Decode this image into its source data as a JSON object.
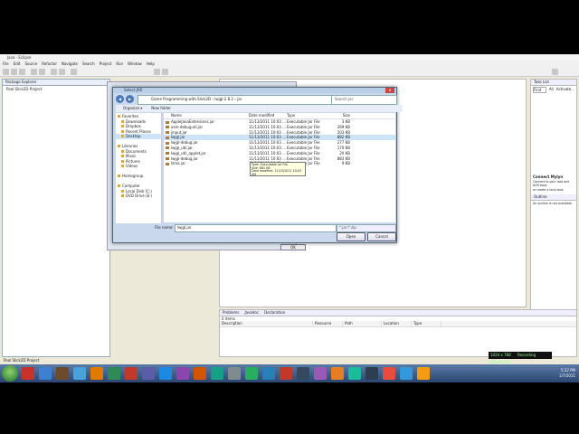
{
  "window": {
    "title": "Java - Eclipse"
  },
  "menu": [
    "File",
    "Edit",
    "Source",
    "Refactor",
    "Navigate",
    "Search",
    "Project",
    "Run",
    "Window",
    "Help"
  ],
  "package_explorer": {
    "tab": "Package Explorer",
    "items": [
      "Pool Slick2D Project"
    ]
  },
  "right_panel": {
    "task_list": "Task List",
    "find_label": "Find",
    "all_label": "All",
    "activate_label": "Activate...",
    "mylyn_title": "Connect Mylyn",
    "mylyn_text1": "Connect to your task and ALM tools",
    "mylyn_text2": "or create a local task.",
    "outline_tab": "Outline",
    "outline_text": "An outline is not available."
  },
  "problems": {
    "tabs": [
      "Problems",
      "Javadoc",
      "Declaration"
    ],
    "count": "0 items",
    "columns": [
      "Description",
      "Resource",
      "Path",
      "Location",
      "Type"
    ]
  },
  "status": {
    "left": "Pool Slick2D Project"
  },
  "recording": {
    "left": "1024 x 768",
    "right": "Recording [00:05:07]"
  },
  "clock": {
    "time": "5:22 PM",
    "date": "1/7/2011"
  },
  "behind_dialog": {
    "ok_label": "OK"
  },
  "dialog": {
    "title": "Select JAR",
    "breadcrumb": "Game Programming with Slick2D  ›  lwjgl-2.8.2  ›  jar",
    "search_placeholder": "Search jar",
    "organize": "Organize ▾",
    "new_folder": "New folder",
    "nav": [
      {
        "label": "Favorites",
        "type": "hdr"
      },
      {
        "label": "Downloads",
        "type": "item"
      },
      {
        "label": "Dropbox",
        "type": "item"
      },
      {
        "label": "Recent Places",
        "type": "item"
      },
      {
        "label": "Desktop",
        "type": "sel"
      },
      {
        "label": "",
        "type": "gap"
      },
      {
        "label": "Libraries",
        "type": "hdr"
      },
      {
        "label": "Documents",
        "type": "item"
      },
      {
        "label": "Music",
        "type": "item"
      },
      {
        "label": "Pictures",
        "type": "item"
      },
      {
        "label": "Videos",
        "type": "item"
      },
      {
        "label": "",
        "type": "gap"
      },
      {
        "label": "Homegroup",
        "type": "hdr"
      },
      {
        "label": "",
        "type": "gap"
      },
      {
        "label": "Computer",
        "type": "hdr"
      },
      {
        "label": "Local Disk (C:)",
        "type": "item"
      },
      {
        "label": "DVD Drive (E:)",
        "type": "item"
      }
    ],
    "columns": [
      "Name",
      "Date modified",
      "Type",
      "Size"
    ],
    "files": [
      {
        "name": "AppleJavaExtensions.jar",
        "date": "11/13/2011 10:03 ...",
        "type": "Executable Jar File",
        "size": "3 KB"
      },
      {
        "name": "asm-debug-all.jar",
        "date": "11/13/2011 10:03 ...",
        "type": "Executable Jar File",
        "size": "269 KB"
      },
      {
        "name": "jinput.jar",
        "date": "11/13/2011 10:03 ...",
        "type": "Executable Jar File",
        "size": "203 KB"
      },
      {
        "name": "lwjgl.jar",
        "date": "11/13/2011 10:03 ...",
        "type": "Executable Jar File",
        "size": "882 KB",
        "sel": true
      },
      {
        "name": "lwjgl-debug.jar",
        "date": "11/13/2011 10:03 ...",
        "type": "Executable Jar File",
        "size": "277 KB"
      },
      {
        "name": "lwjgl_util.jar",
        "date": "11/13/2011 10:03 ...",
        "type": "Executable Jar File",
        "size": "170 KB"
      },
      {
        "name": "lwjgl_util_applet.jar",
        "date": "11/13/2011 10:03 ...",
        "type": "Executable Jar File",
        "size": "20 KB"
      },
      {
        "name": "lwjgl-debug.jar",
        "date": "11/13/2011 10:03 ...",
        "type": "Executable Jar File",
        "size": "883 KB"
      },
      {
        "name": "lzma.jar",
        "date": "11/13/2011 10:03 ...",
        "type": "Executable Jar File",
        "size": "9 KB"
      }
    ],
    "tooltip": {
      "line1": "Type: Executable Jar File",
      "line2": "Size: 882 KB",
      "line3": "Date modified: 11/13/2011 10:03 AM"
    },
    "filename_label": "File name:",
    "filename_value": "lwjgl.jar",
    "filetype_value": "*.jar;*.zip",
    "open_label": "Open",
    "cancel_label": "Cancel"
  },
  "taskbar_colors": [
    "#c83228",
    "#3d7fd0",
    "#6c4a2a",
    "#4aa3d8",
    "#e07b00",
    "#2e8b57",
    "#c0392b",
    "#5b5ea6",
    "#1e88e5",
    "#8e44ad",
    "#d35400",
    "#16a085",
    "#7f8c8d",
    "#27ae60",
    "#2980b9",
    "#c0392b",
    "#34495e",
    "#9b59b6",
    "#e67e22",
    "#1abc9c",
    "#2c3e50",
    "#e74c3c",
    "#3498db",
    "#f39c12"
  ]
}
